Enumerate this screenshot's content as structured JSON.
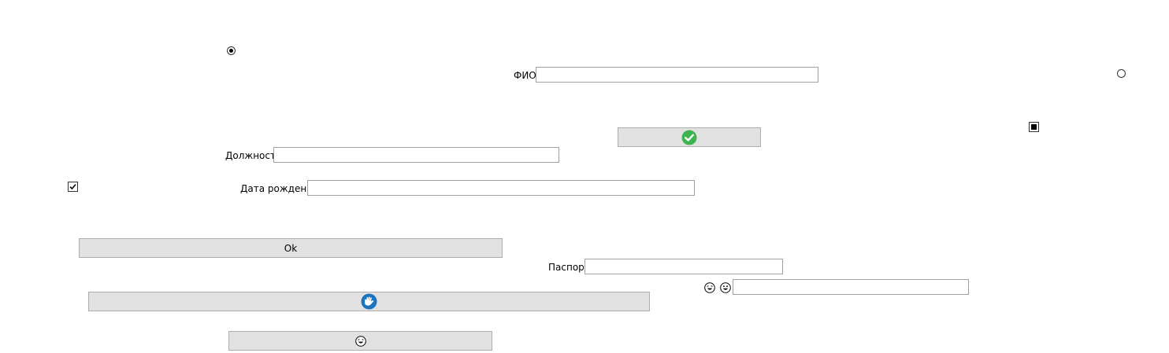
{
  "form": {
    "fio_label": "ФИО",
    "fio_value": "",
    "position_label": "Должность",
    "position_value": "",
    "birthdate_label": "Дата рождения",
    "birthdate_value": "",
    "passport_label": "Паспорт",
    "passport_value": "",
    "emoji_field_value": ""
  },
  "buttons": {
    "ok_label": "Ok",
    "accept_icon": "check-circle-icon",
    "hand_icon": "wave-hand-icon",
    "laugh_icon": "laughing-face-icon"
  },
  "controls": {
    "radio_top_left": {
      "checked": true
    },
    "radio_top_right": {
      "checked": false
    },
    "checkbox_left": {
      "checked": true
    },
    "checkbox_right": {
      "state": "indeterminate"
    }
  },
  "colors": {
    "accept_green": "#3fb34f",
    "hand_blue": "#1e73be",
    "button_face": "#e1e1e1",
    "field_border": "#a0a0a0"
  }
}
